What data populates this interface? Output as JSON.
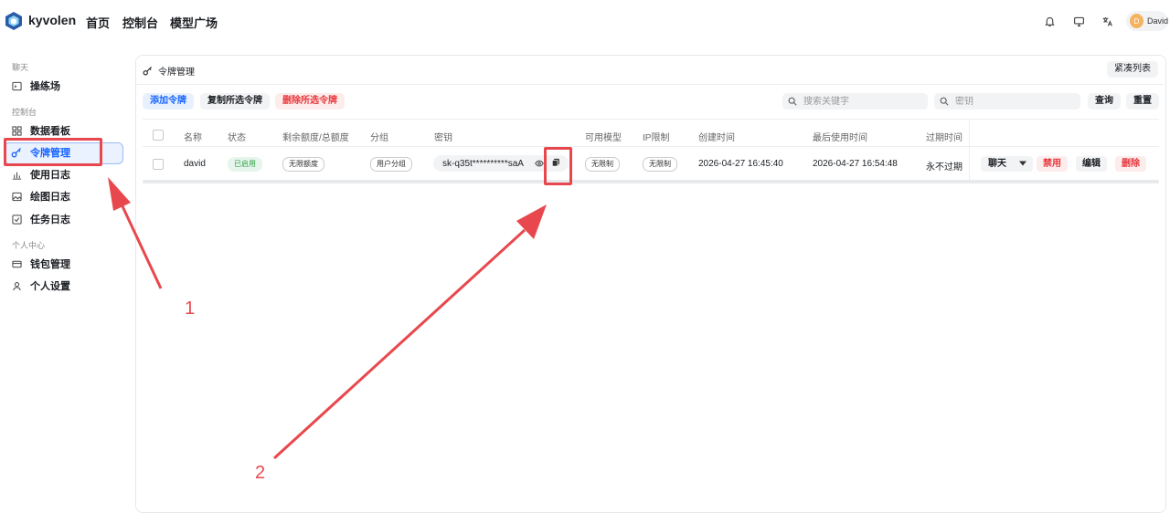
{
  "header": {
    "brand": "kyvolen",
    "nav": [
      "首页",
      "控制台",
      "模型广场"
    ],
    "user_initial": "D",
    "user_name": "David"
  },
  "sidebar": {
    "sections": [
      {
        "label": "聊天",
        "items": [
          "操练场"
        ]
      },
      {
        "label": "控制台",
        "items": [
          "数据看板",
          "令牌管理",
          "使用日志",
          "绘图日志",
          "任务日志"
        ]
      },
      {
        "label": "个人中心",
        "items": [
          "钱包管理",
          "个人设置"
        ]
      }
    ],
    "active_item": "令牌管理"
  },
  "page": {
    "title": "令牌管理",
    "compact_toggle": "紧凑列表",
    "toolbar": {
      "add": "添加令牌",
      "copy_selected": "复制所选令牌",
      "delete_selected": "删除所选令牌"
    },
    "search": {
      "keyword_placeholder": "搜索关键字",
      "key_placeholder": "密钥",
      "query": "查询",
      "reset": "重置"
    }
  },
  "table": {
    "headers": [
      "名称",
      "状态",
      "剩余额度/总额度",
      "分组",
      "密钥",
      "可用模型",
      "IP限制",
      "创建时间",
      "最后使用时间",
      "过期时间"
    ],
    "rows": [
      {
        "name": "david",
        "status": "已启用",
        "quota": "无限额度",
        "group": "用户分组",
        "key": "sk-q35t**********saA",
        "models": "无限制",
        "ip": "无限制",
        "created": "2026-04-27 16:45:40",
        "last_used": "2026-04-27 16:54:48",
        "expires": "永不过期",
        "actions": {
          "chat": "聊天",
          "disable": "禁用",
          "edit": "编辑",
          "delete": "删除"
        }
      }
    ]
  },
  "annotations": {
    "marker1": "1",
    "marker2": "2"
  },
  "colors": {
    "accent": "#1664ff",
    "annotation": "#e8484d",
    "danger": "#e8363a",
    "success": "#2ea043"
  }
}
